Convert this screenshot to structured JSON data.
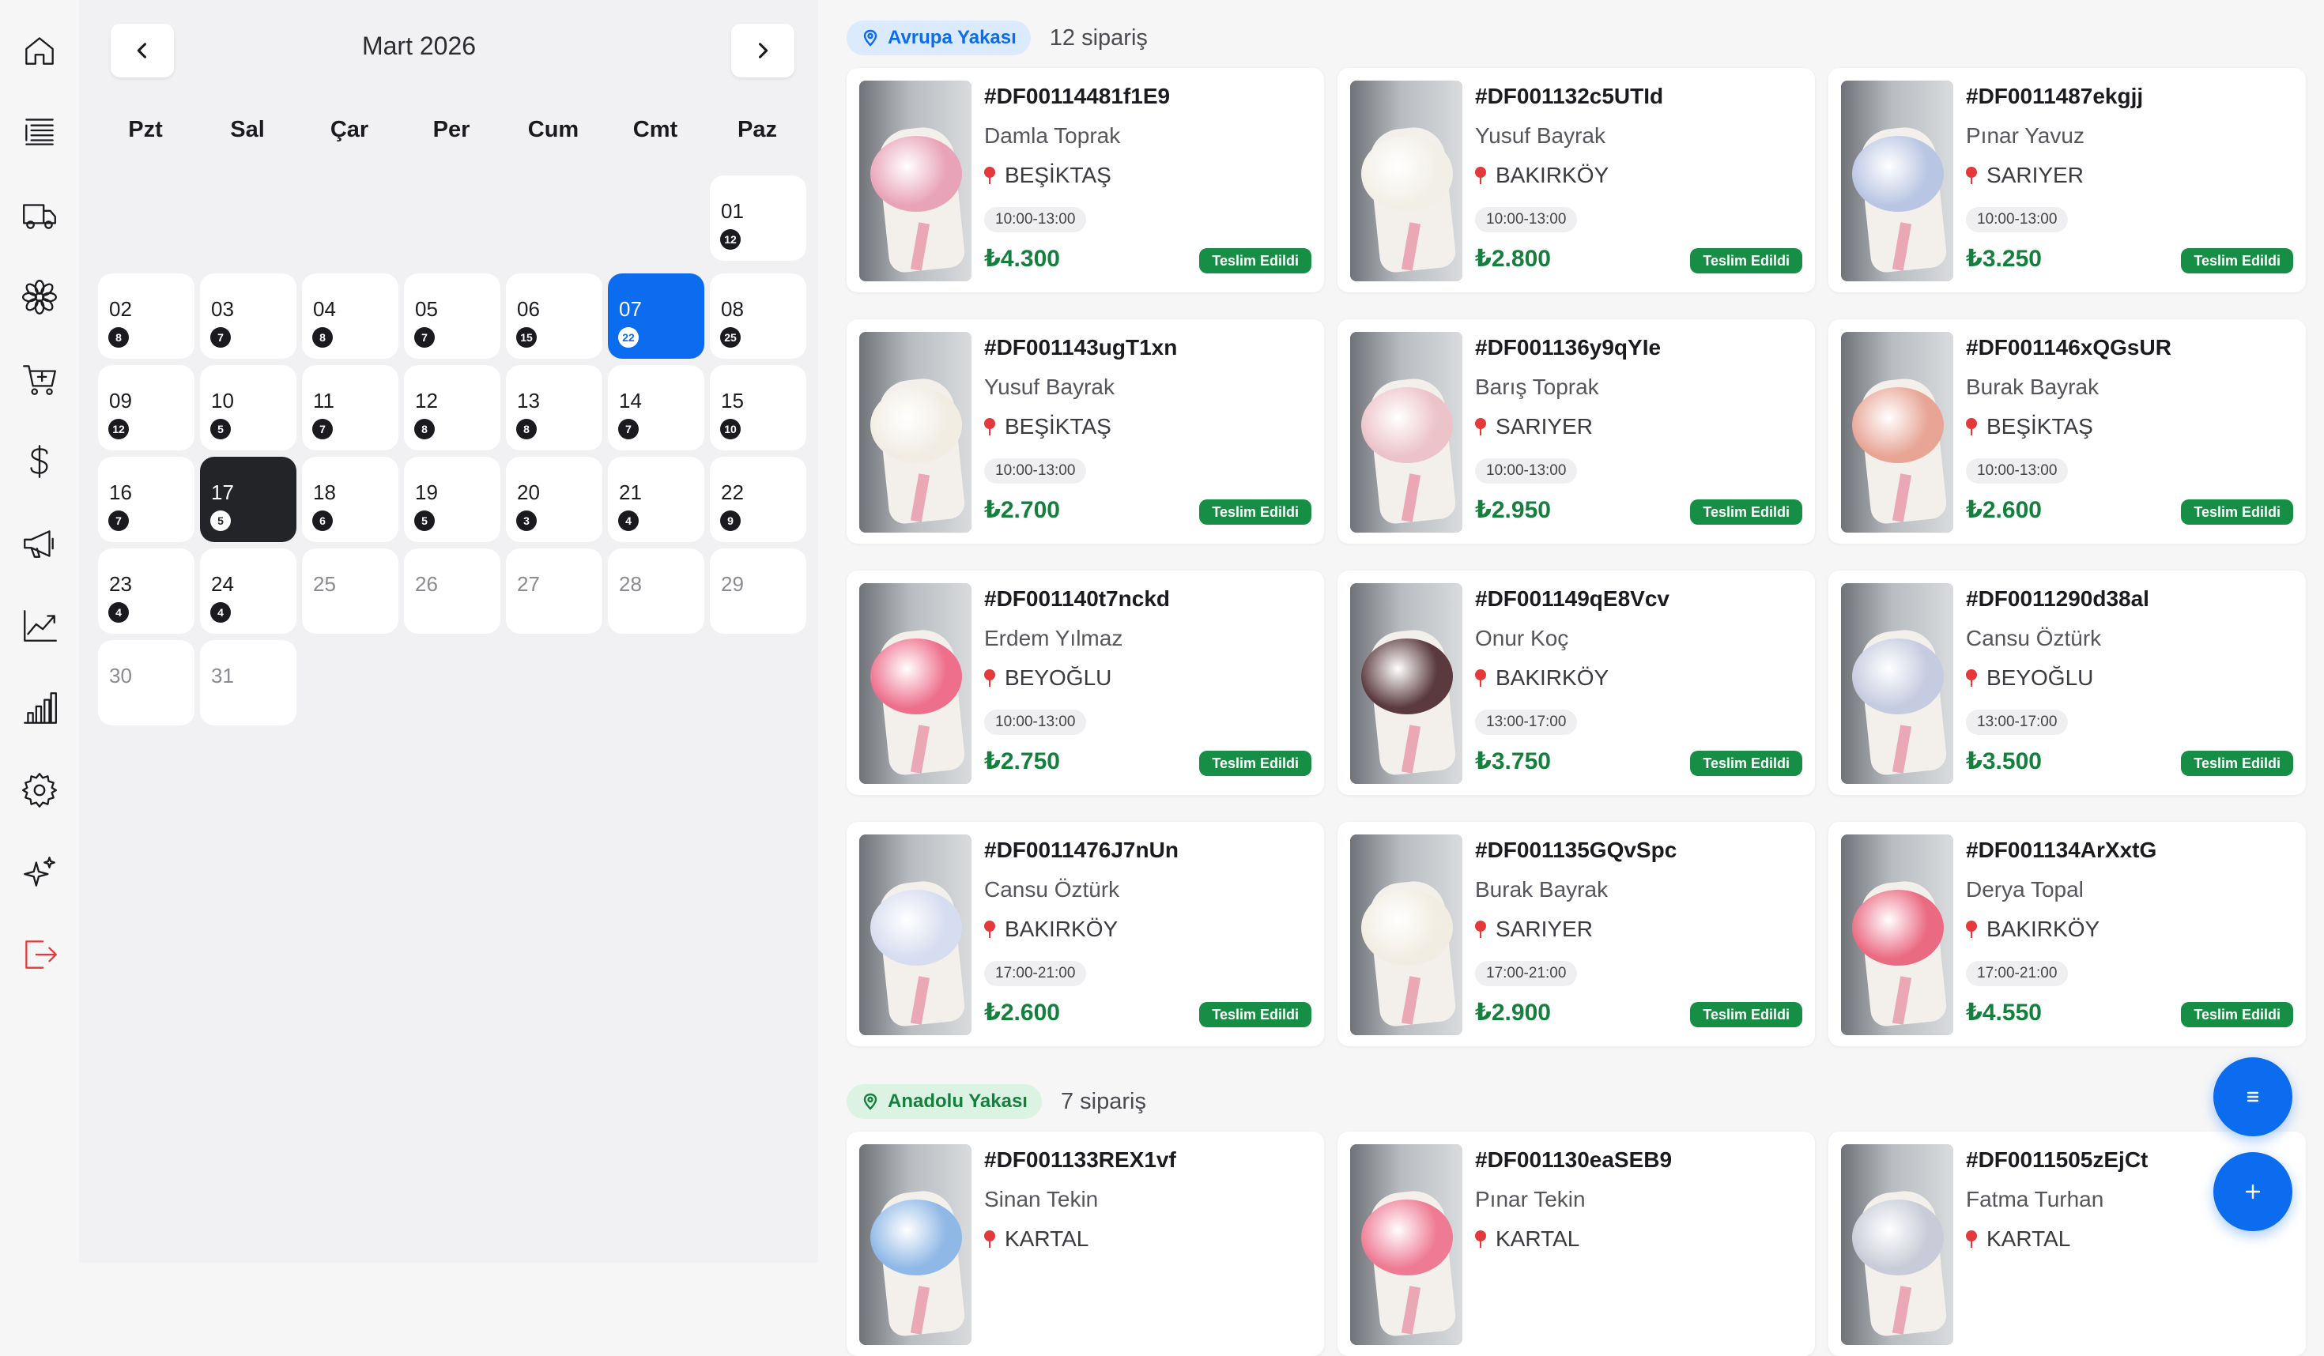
{
  "calendar": {
    "month_title": "Mart 2026",
    "weekdays": [
      "Pzt",
      "Sal",
      "Çar",
      "Per",
      "Cum",
      "Cmt",
      "Paz"
    ],
    "days": [
      {
        "num": "01",
        "count": "12"
      },
      {
        "num": "02",
        "count": "8"
      },
      {
        "num": "03",
        "count": "7"
      },
      {
        "num": "04",
        "count": "8"
      },
      {
        "num": "05",
        "count": "7"
      },
      {
        "num": "06",
        "count": "15"
      },
      {
        "num": "07",
        "count": "22",
        "state": "selected"
      },
      {
        "num": "08",
        "count": "25"
      },
      {
        "num": "09",
        "count": "12"
      },
      {
        "num": "10",
        "count": "5"
      },
      {
        "num": "11",
        "count": "7"
      },
      {
        "num": "12",
        "count": "8"
      },
      {
        "num": "13",
        "count": "8"
      },
      {
        "num": "14",
        "count": "7"
      },
      {
        "num": "15",
        "count": "10"
      },
      {
        "num": "16",
        "count": "7"
      },
      {
        "num": "17",
        "count": "5",
        "state": "today"
      },
      {
        "num": "18",
        "count": "6"
      },
      {
        "num": "19",
        "count": "5"
      },
      {
        "num": "20",
        "count": "3"
      },
      {
        "num": "21",
        "count": "4"
      },
      {
        "num": "22",
        "count": "9"
      },
      {
        "num": "23",
        "count": "4"
      },
      {
        "num": "24",
        "count": "4"
      },
      {
        "num": "25",
        "count": ""
      },
      {
        "num": "26",
        "count": ""
      },
      {
        "num": "27",
        "count": ""
      },
      {
        "num": "28",
        "count": ""
      },
      {
        "num": "29",
        "count": ""
      },
      {
        "num": "30",
        "count": ""
      },
      {
        "num": "31",
        "count": ""
      }
    ]
  },
  "sidebar": {
    "icons": [
      "home-icon",
      "orders-list-icon",
      "delivery-truck-icon",
      "flower-icon",
      "add-to-cart-icon",
      "dollar-icon",
      "megaphone-icon",
      "trend-chart-icon",
      "bar-chart-icon",
      "settings-gear-icon",
      "sparkles-icon",
      "logout-icon"
    ]
  },
  "regions": [
    {
      "name": "Avrupa Yakası",
      "count": "12 sipariş",
      "color": "#0b6cf0",
      "orders": [
        {
          "id": "#DF00114481f1E9",
          "customer": "Damla Toprak",
          "district": "BEŞİKTAŞ",
          "slot": "10:00-13:00",
          "price": "₺4.300",
          "status": "Teslim Edildi",
          "bloom": "#e9a3b9"
        },
        {
          "id": "#DF001132c5UTId",
          "customer": "Yusuf Bayrak",
          "district": "BAKIRKÖY",
          "slot": "10:00-13:00",
          "price": "₺2.800",
          "status": "Teslim Edildi",
          "bloom": "#f2efe6"
        },
        {
          "id": "#DF0011487ekgjj",
          "customer": "Pınar Yavuz",
          "district": "SARIYER",
          "slot": "10:00-13:00",
          "price": "₺3.250",
          "status": "Teslim Edildi",
          "bloom": "#b9c6e3"
        },
        {
          "id": "#DF001143ugT1xn",
          "customer": "Yusuf Bayrak",
          "district": "BEŞİKTAŞ",
          "slot": "10:00-13:00",
          "price": "₺2.700",
          "status": "Teslim Edildi",
          "bloom": "#f1ede3"
        },
        {
          "id": "#DF001136y9qYIe",
          "customer": "Barış Toprak",
          "district": "SARIYER",
          "slot": "10:00-13:00",
          "price": "₺2.950",
          "status": "Teslim Edildi",
          "bloom": "#ecc3c9"
        },
        {
          "id": "#DF001146xQGsUR",
          "customer": "Burak Bayrak",
          "district": "BEŞİKTAŞ",
          "slot": "10:00-13:00",
          "price": "₺2.600",
          "status": "Teslim Edildi",
          "bloom": "#e8a596"
        },
        {
          "id": "#DF001140t7nckd",
          "customer": "Erdem Yılmaz",
          "district": "BEYOĞLU",
          "slot": "10:00-13:00",
          "price": "₺2.750",
          "status": "Teslim Edildi",
          "bloom": "#ee6f8b"
        },
        {
          "id": "#DF001149qE8Vcv",
          "customer": "Onur Koç",
          "district": "BAKIRKÖY",
          "slot": "13:00-17:00",
          "price": "₺3.750",
          "status": "Teslim Edildi",
          "bloom": "#5a3a3e"
        },
        {
          "id": "#DF0011290d38al",
          "customer": "Cansu Öztürk",
          "district": "BEYOĞLU",
          "slot": "13:00-17:00",
          "price": "₺3.500",
          "status": "Teslim Edildi",
          "bloom": "#c5cbe0"
        },
        {
          "id": "#DF0011476J7nUn",
          "customer": "Cansu Öztürk",
          "district": "BAKIRKÖY",
          "slot": "17:00-21:00",
          "price": "₺2.600",
          "status": "Teslim Edildi",
          "bloom": "#d7ddf0"
        },
        {
          "id": "#DF001135GQvSpc",
          "customer": "Burak Bayrak",
          "district": "SARIYER",
          "slot": "17:00-21:00",
          "price": "₺2.900",
          "status": "Teslim Edildi",
          "bloom": "#f1ede2"
        },
        {
          "id": "#DF001134ArXxtG",
          "customer": "Derya Topal",
          "district": "BAKIRKÖY",
          "slot": "17:00-21:00",
          "price": "₺4.550",
          "status": "Teslim Edildi",
          "bloom": "#ea6a82"
        }
      ]
    },
    {
      "name": "Anadolu Yakası",
      "count": "7 sipariş",
      "color": "#15803d",
      "orders": [
        {
          "id": "#DF001133REX1vf",
          "customer": "Sinan Tekin",
          "district": "KARTAL",
          "bloom": "#8fb8e6"
        },
        {
          "id": "#DF001130eaSEB9",
          "customer": "Pınar Tekin",
          "district": "KARTAL",
          "bloom": "#ee7a93"
        },
        {
          "id": "#DF0011505zEjCt",
          "customer": "Fatma Turhan",
          "district": "KARTAL",
          "bloom": "#c9ccd8"
        }
      ]
    }
  ],
  "fab": {
    "list_icon": "list-icon",
    "add_icon": "plus-icon"
  }
}
